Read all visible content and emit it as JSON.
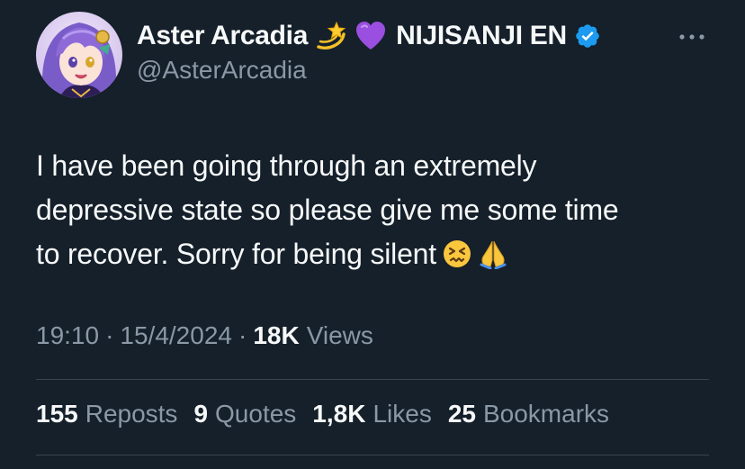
{
  "author": {
    "display_name": "Aster Arcadia",
    "name_emojis": [
      "dizzy-icon",
      "purple-heart-icon"
    ],
    "affiliation": "NIJISANJI EN",
    "handle": "@AsterArcadia",
    "verified": true
  },
  "tweet": {
    "lines": [
      "I have been going through an extremely",
      "depressive state so please give me some time",
      "to recover. Sorry for being silent"
    ],
    "trailing_emojis": [
      "confounded-face-icon",
      "folded-hands-icon"
    ]
  },
  "meta": {
    "time": "19:10",
    "separator": "·",
    "date": "15/4/2024",
    "views_count": "18K",
    "views_label": "Views"
  },
  "stats": [
    {
      "count": "155",
      "label": "Reposts"
    },
    {
      "count": "9",
      "label": "Quotes"
    },
    {
      "count": "1,8K",
      "label": "Likes"
    },
    {
      "count": "25",
      "label": "Bookmarks"
    }
  ],
  "colors": {
    "background": "#15202b",
    "primary_text": "#f7f9f9",
    "secondary_text": "#8b98a5",
    "divider": "#38444d",
    "verified_blue": "#1d9bf0"
  }
}
